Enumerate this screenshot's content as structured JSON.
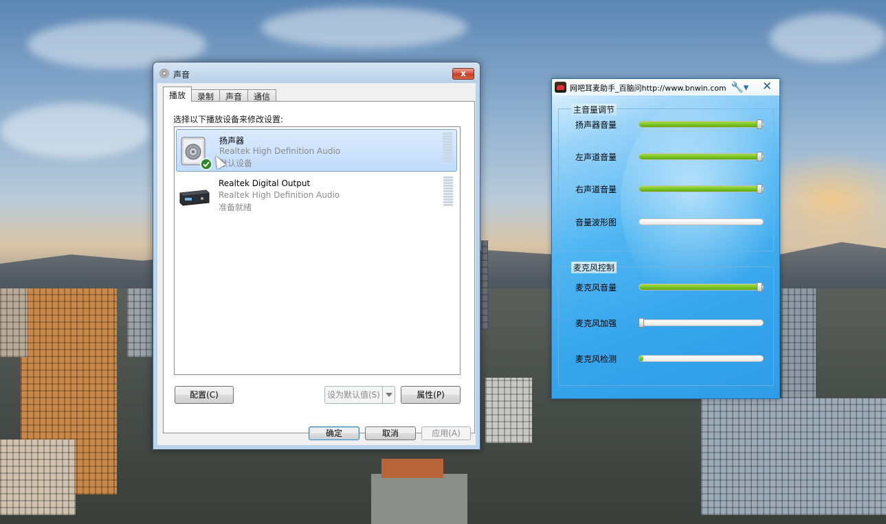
{
  "sound_dialog": {
    "title": "声音",
    "close_label": "x",
    "tabs": [
      "播放",
      "录制",
      "声音",
      "通信"
    ],
    "active_tab": "播放",
    "instruction": "选择以下播放设备来修改设置:",
    "devices": [
      {
        "name": "扬声器",
        "driver": "Realtek High Definition Audio",
        "status": "默认设备",
        "selected": true,
        "icon": "speaker-icon",
        "default_badge": "check-badge-icon"
      },
      {
        "name": "Realtek Digital Output",
        "driver": "Realtek High Definition Audio",
        "status": "准备就绪",
        "selected": false,
        "icon": "digital-output-icon"
      }
    ],
    "buttons": {
      "configure": "配置(C)",
      "set_default": "设为默认值(S)",
      "properties": "属性(P)",
      "ok": "确定",
      "cancel": "取消",
      "apply": "应用(A)"
    }
  },
  "netbar_helper": {
    "title": "网吧耳麦助手_百脑问http://www.bnwin.com",
    "icons": [
      "wrench-icon",
      "close-icon"
    ],
    "close_label": "✕",
    "groups": [
      {
        "title": "主音量调节",
        "controls": [
          {
            "label": "扬声器音量",
            "level": 1.0
          },
          {
            "label": "左声道音量",
            "level": 1.0
          },
          {
            "label": "右声道音量",
            "level": 1.0
          },
          {
            "label": "音量波形图",
            "level": 0.0
          }
        ]
      },
      {
        "title": "麦克风控制",
        "controls": [
          {
            "label": "麦克风音量",
            "level": 1.0
          },
          {
            "label": "麦克风加强",
            "level": 0.0
          },
          {
            "label": "麦克风检测",
            "level": 0.03
          }
        ]
      }
    ],
    "colors": {
      "slider_fill": "#74c11e",
      "window_blue": "#37a6ec"
    }
  }
}
